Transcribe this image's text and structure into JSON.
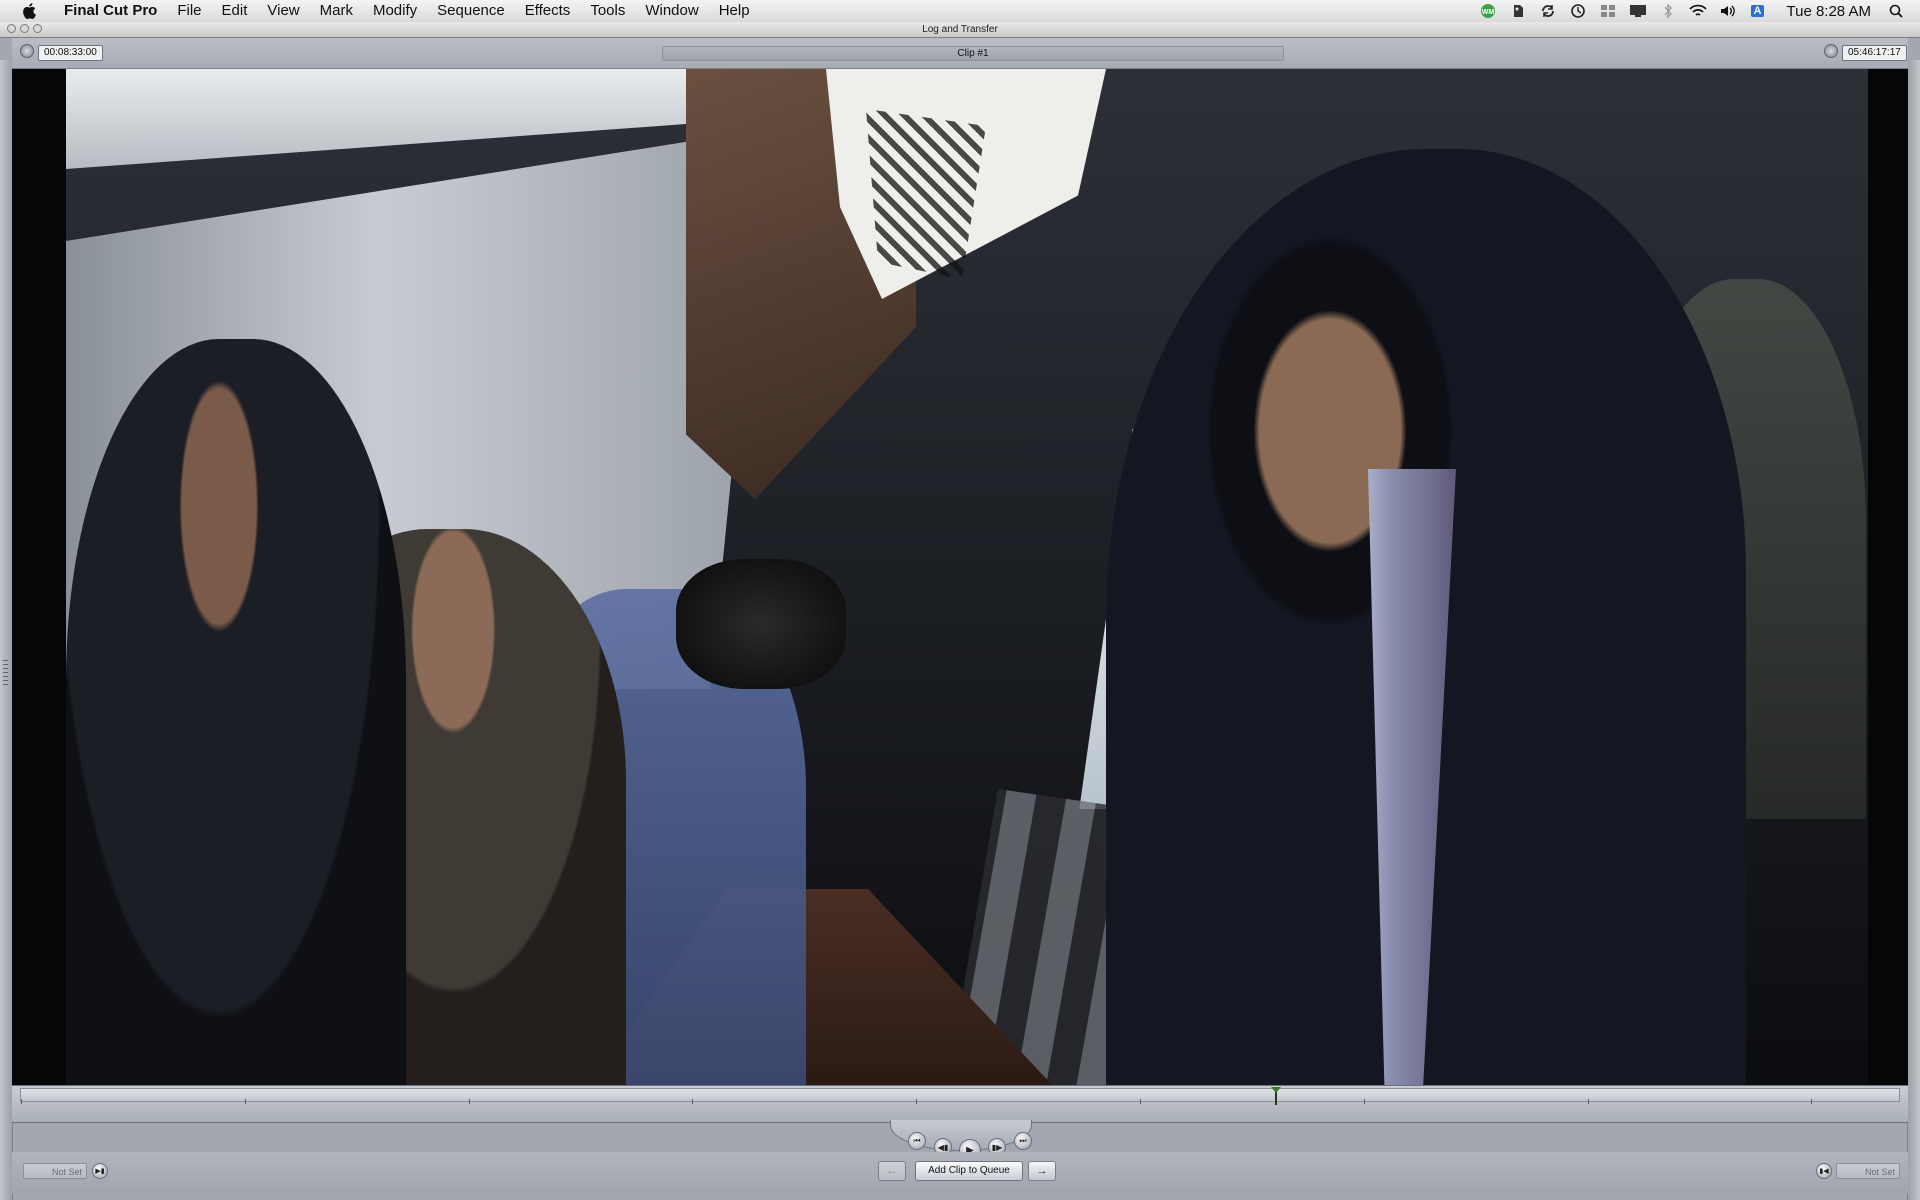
{
  "menubar": {
    "app_name": "Final Cut Pro",
    "items": [
      "File",
      "Edit",
      "View",
      "Mark",
      "Modify",
      "Sequence",
      "Effects",
      "Tools",
      "Window",
      "Help"
    ],
    "status_icons": [
      "wm-icon",
      "evernote-icon",
      "sync-icon",
      "time-machine-icon",
      "spaces-icon",
      "display-icon",
      "bluetooth-icon",
      "wifi-icon",
      "volume-icon",
      "input-source-icon"
    ],
    "input_source_label": "A",
    "clock": "Tue 8:28 AM"
  },
  "window": {
    "title": "Log and Transfer"
  },
  "viewer": {
    "duration_timecode": "00:08:33:00",
    "current_timecode": "05:46:17:17",
    "clip_name": "Clip #1",
    "playhead_position": 0.667
  },
  "transport": {
    "buttons": [
      "go-to-start",
      "previous-frame",
      "play",
      "next-frame",
      "go-to-end"
    ]
  },
  "bottom_bar": {
    "in_point_label": "Not Set",
    "out_point_label": "Not Set",
    "add_clip_label": "Add Clip to Queue"
  },
  "colors": {
    "play_accent": "#3a7a2a",
    "window_bg": "#a3a8b0"
  }
}
